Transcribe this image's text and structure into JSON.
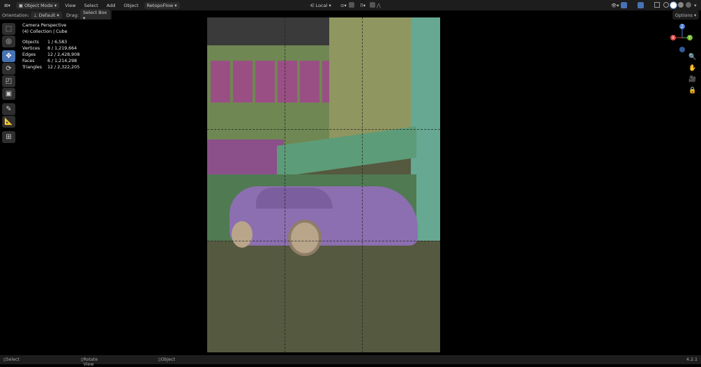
{
  "header": {
    "mode": "Object Mode",
    "menus": [
      "View",
      "Select",
      "Add",
      "Object"
    ],
    "addon": "RetopoFlow",
    "transform_orientation": "Local",
    "options": "Options"
  },
  "toolbar": {
    "orientation_label": "Orientation:",
    "orientation_value": "Default",
    "drag_label": "Drag:",
    "drag_value": "Select Box"
  },
  "overlay": {
    "view": "Camera Perspective",
    "collection": "(4) Collection | Cube",
    "stats": [
      [
        "Objects",
        "1 / 6,583"
      ],
      [
        "Vertices",
        "8 / 1,219,664"
      ],
      [
        "Edges",
        "12 / 2,428,908"
      ],
      [
        "Faces",
        "6 / 1,214,298"
      ],
      [
        "Triangles",
        "12 / 2,322,205"
      ]
    ]
  },
  "tools": [
    "select-box-icon",
    "cursor-icon",
    "move-icon",
    "rotate-icon",
    "scale-icon",
    "transform-icon",
    "annotate-icon",
    "measure-icon",
    "add-cube-icon"
  ],
  "gizmo": {
    "z": "Z",
    "x": "X",
    "y": "Y"
  },
  "status": {
    "select": "Select",
    "rotate": "Rotate View",
    "object": "Object",
    "version": "4.2.1"
  },
  "colors": {
    "accent": "#4772b3",
    "header": "#1d1d1d"
  }
}
